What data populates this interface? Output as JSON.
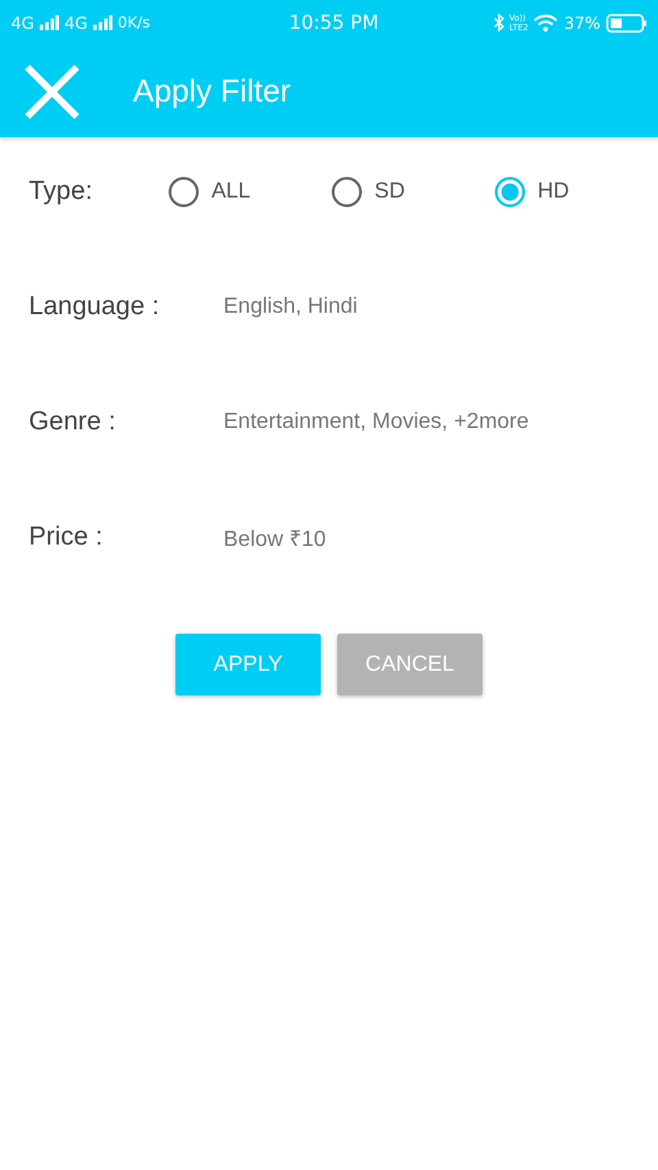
{
  "status_bar": {
    "network_1": "4G",
    "network_2": "4G",
    "speed": "0K/s",
    "time": "10:55 PM",
    "volte_top": "Vo))",
    "volte_bottom": "LTE2",
    "battery": "37%"
  },
  "app_bar": {
    "title": "Apply Filter"
  },
  "type": {
    "label": "Type:",
    "options": [
      {
        "label": "ALL",
        "selected": false
      },
      {
        "label": "SD",
        "selected": false
      },
      {
        "label": "HD",
        "selected": true
      }
    ]
  },
  "fields": [
    {
      "label": "Language :",
      "value": "English, Hindi"
    },
    {
      "label": "Genre :",
      "value": "Entertainment, Movies, +2more"
    },
    {
      "label": "Price :",
      "value": "Below ₹10"
    }
  ],
  "buttons": [
    {
      "label": "APPLY",
      "disabled": false
    },
    {
      "label": "CANCEL",
      "disabled": true
    }
  ]
}
